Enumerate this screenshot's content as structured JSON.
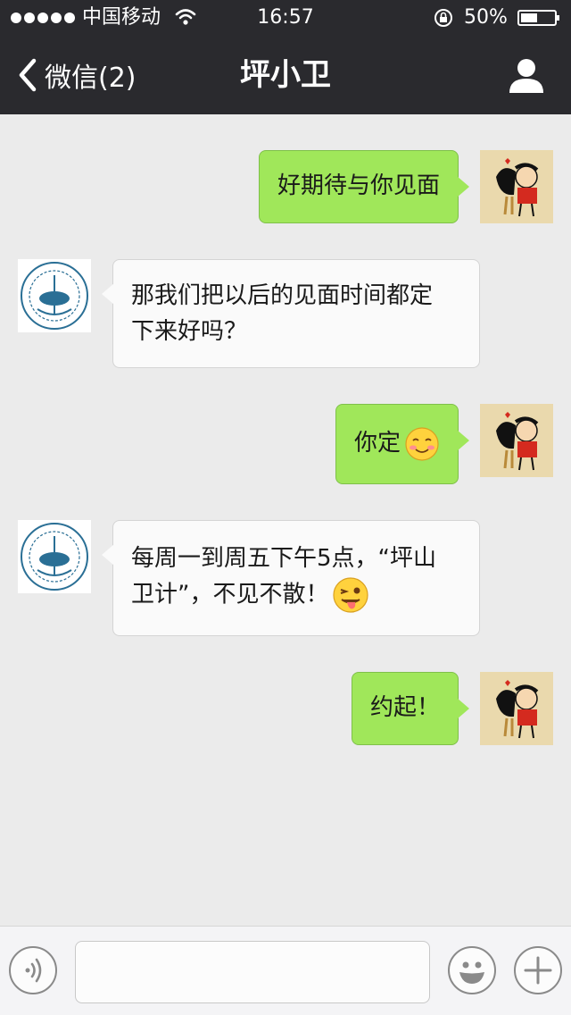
{
  "status_bar": {
    "carrier": "中国移动",
    "time": "16:57",
    "battery_text": "50%",
    "battery_level": 0.5,
    "signal_dots": 5,
    "icons": [
      "signal-dots-icon",
      "wifi-icon",
      "rotation-lock-icon",
      "battery-icon"
    ]
  },
  "nav": {
    "back_label": "微信(2)",
    "title": "坪小卫",
    "icons": [
      "chevron-left-icon",
      "person-icon"
    ]
  },
  "messages": [
    {
      "side": "out",
      "text": "好期待与你见面"
    },
    {
      "side": "in",
      "lines": [
        "那我们把以后的见面时间都定",
        "下来好吗？"
      ]
    },
    {
      "side": "out",
      "text": "你定",
      "emoji": "smiling-blush-emoji"
    },
    {
      "side": "in",
      "lines": [
        "每周一到周五下午5点，“坪山",
        "卫计”，不见不散！"
      ],
      "emoji": "winking-tongue-emoji"
    },
    {
      "side": "out",
      "text": "约起！"
    }
  ],
  "input_bar": {
    "value": "",
    "icons": [
      "voice-icon",
      "emoji-face-icon",
      "plus-icon"
    ]
  },
  "colors": {
    "nav_bg": "#2a2a2e",
    "chat_bg": "#ebebeb",
    "outgoing_bubble": "#a0e75a",
    "incoming_bubble": "#fafafa"
  }
}
